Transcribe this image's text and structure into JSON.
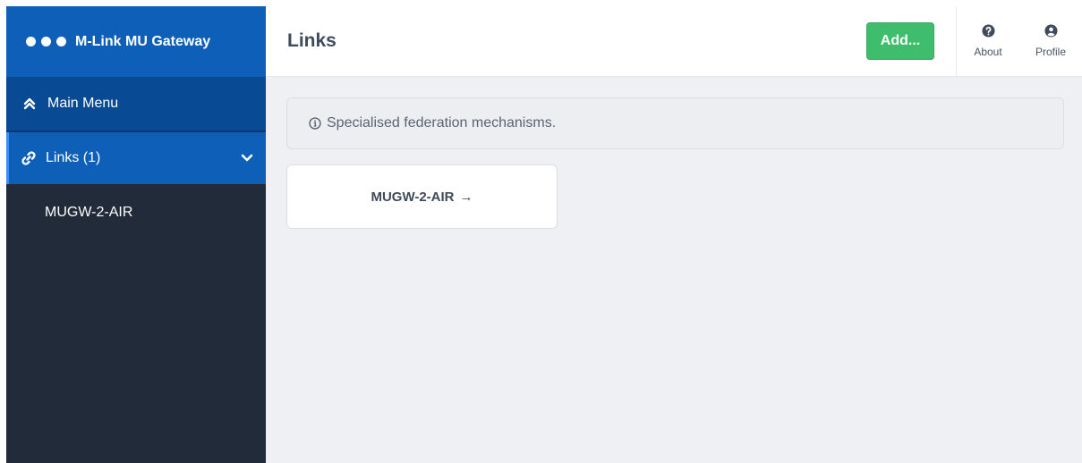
{
  "app": {
    "name": "M-Link MU Gateway",
    "accent": "#0d5fb8",
    "sidebar_bg": "#212b39",
    "success": "#3ebd6c"
  },
  "sidebar": {
    "main_menu": {
      "label": "Main Menu",
      "icon": "double-chevron-up-icon"
    },
    "links": {
      "label": "Links (1)",
      "icon": "link-icon",
      "expand_icon": "chevron-down-icon"
    },
    "items": [
      {
        "label": "MUGW-2-AIR"
      }
    ]
  },
  "header": {
    "title": "Links",
    "add_label": "Add...",
    "about_label": "About",
    "about_icon": "question-circle-icon",
    "profile_label": "Profile",
    "profile_icon": "user-circle-icon"
  },
  "main": {
    "info_text": "Specialised federation mechanisms.",
    "info_icon": "info-circle-icon",
    "cards": [
      {
        "label": "MUGW-2-AIR",
        "arrow": "→"
      }
    ]
  }
}
